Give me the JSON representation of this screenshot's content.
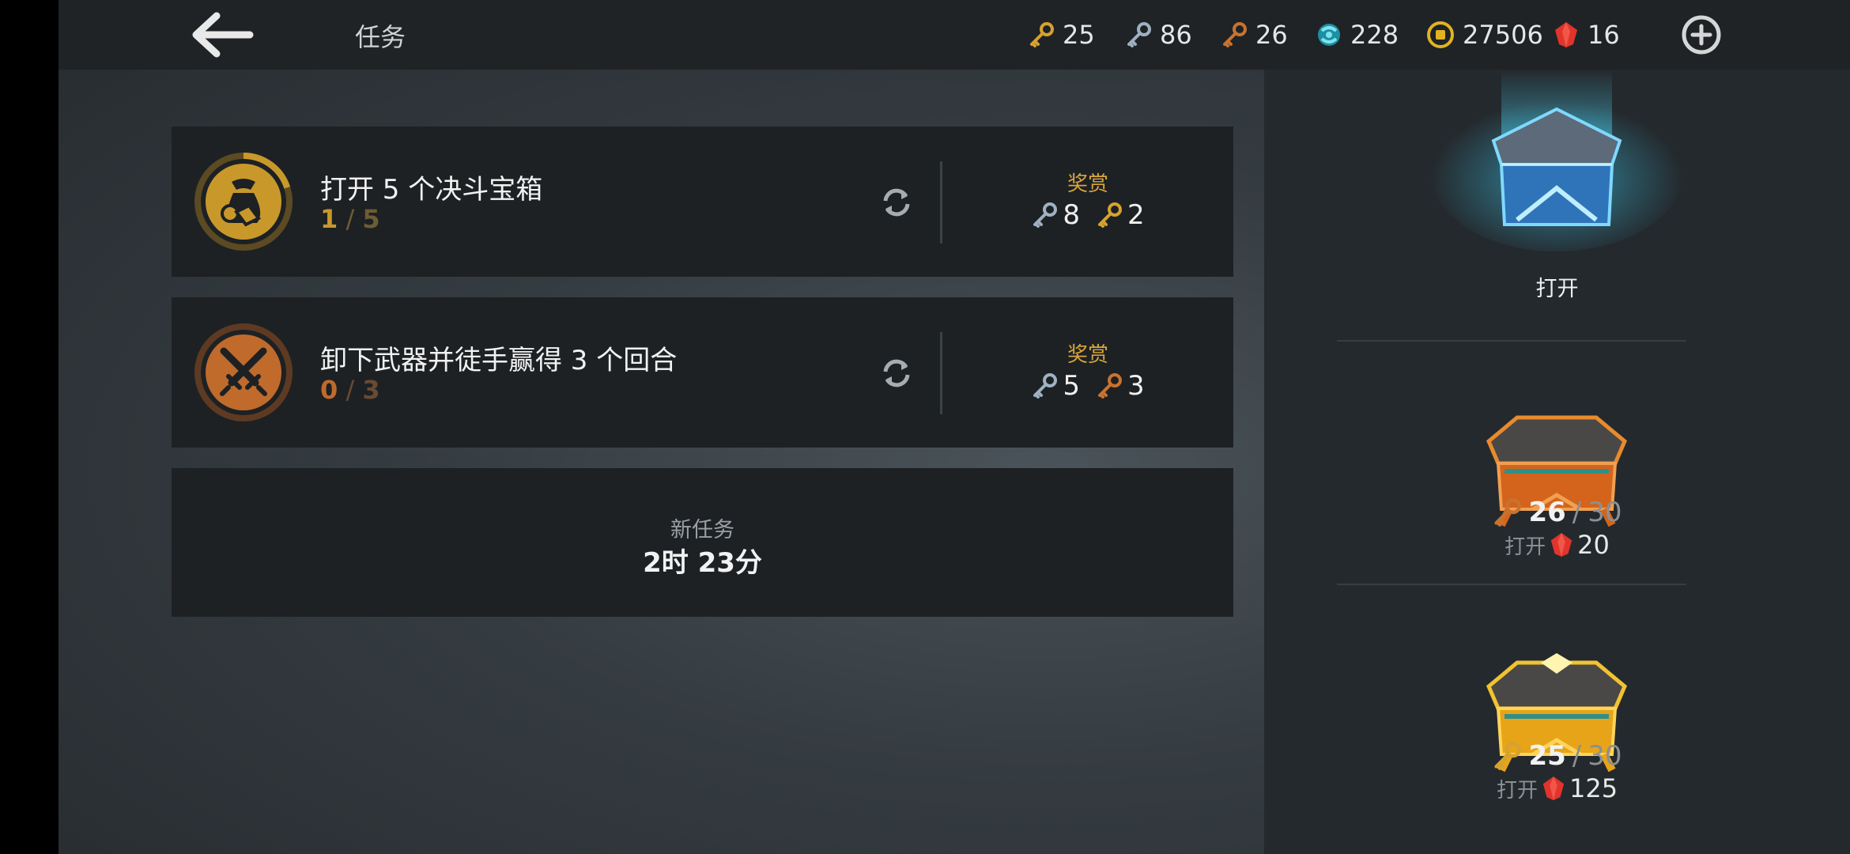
{
  "header": {
    "title": "任务",
    "back_icon": "back-arrow-icon",
    "add_icon": "plus-circle-icon"
  },
  "currencies": [
    {
      "name": "gold-key",
      "icon": "gold-key-icon",
      "value": "25",
      "color": "#d6a22f"
    },
    {
      "name": "silver-key",
      "icon": "silver-key-icon",
      "value": "86",
      "color": "#9fb0c2"
    },
    {
      "name": "bronze-key",
      "icon": "bronze-key-icon",
      "value": "26",
      "color": "#c7732f"
    },
    {
      "name": "orb",
      "icon": "orb-icon",
      "value": "228",
      "color": "#2ba6b8"
    },
    {
      "name": "coin",
      "icon": "coin-icon",
      "value": "27506",
      "color": "#e2b321"
    },
    {
      "name": "ruby",
      "icon": "ruby-icon",
      "value": "16",
      "color": "#e0342c"
    }
  ],
  "quests": [
    {
      "name": "打开 5 个决斗宝箱",
      "progress_current": "1",
      "progress_sep": " / ",
      "progress_total": "5",
      "progress_fraction": 0.2,
      "accent": "#c9982b",
      "icon": "money-bag-icon",
      "reward_label": "奖赏",
      "rewards": [
        {
          "icon": "silver-key-icon",
          "value": "8"
        },
        {
          "icon": "gold-key-icon",
          "value": "2"
        }
      ]
    },
    {
      "name": "卸下武器并徒手赢得 3 个回合",
      "progress_current": "0",
      "progress_sep": " / ",
      "progress_total": "3",
      "progress_fraction": 0,
      "accent": "#c06a2c",
      "icon": "crossed-swords-icon",
      "reward_label": "奖赏",
      "rewards": [
        {
          "icon": "silver-key-icon",
          "value": "5"
        },
        {
          "icon": "bronze-key-icon",
          "value": "3"
        }
      ]
    }
  ],
  "new_quest": {
    "label": "新任务",
    "time": "2时 23分"
  },
  "chests": [
    {
      "name": "silver-chest",
      "open_label": "打开"
    },
    {
      "name": "bronze-chest",
      "key_icon": "bronze-key-icon",
      "current": "26",
      "sep": "/",
      "max": "30",
      "open_label": "打开",
      "gem_icon": "ruby-icon",
      "gem_cost": "20"
    },
    {
      "name": "gold-chest",
      "key_icon": "gold-key-icon",
      "current": "25",
      "sep": "/",
      "max": "30",
      "open_label": "打开",
      "gem_icon": "ruby-icon",
      "gem_cost": "125"
    }
  ]
}
